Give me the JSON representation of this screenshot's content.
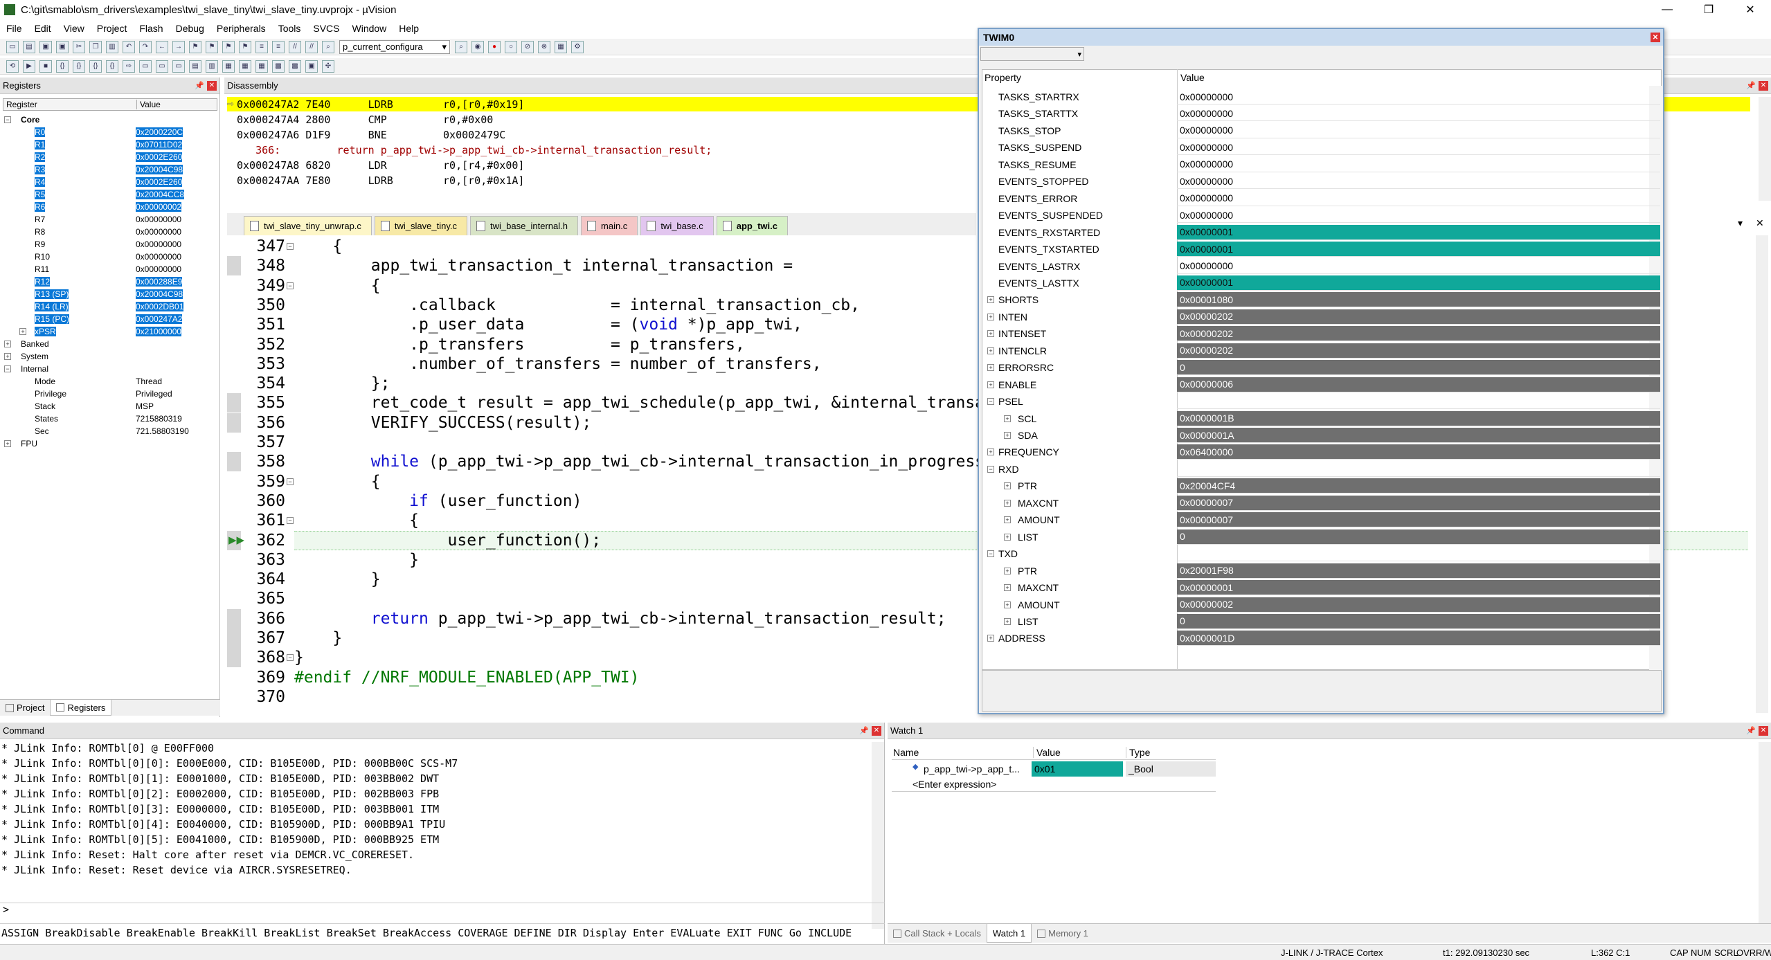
{
  "window": {
    "title": "C:\\git\\smablo\\sm_drivers\\examples\\twi_slave_tiny\\twi_slave_tiny.uvprojx - µVision",
    "minimize": "—",
    "maximize": "❐",
    "close": "✕"
  },
  "menu": [
    "File",
    "Edit",
    "View",
    "Project",
    "Flash",
    "Debug",
    "Peripherals",
    "Tools",
    "SVCS",
    "Window",
    "Help"
  ],
  "toolbar": {
    "config": "p_current_configura"
  },
  "registers": {
    "title": "Registers",
    "col_register": "Register",
    "col_value": "Value",
    "core_label": "Core",
    "rows": [
      {
        "name": "R0",
        "value": "0x2000220C",
        "sel": true
      },
      {
        "name": "R1",
        "value": "0x07011D02",
        "sel": true
      },
      {
        "name": "R2",
        "value": "0x0002E260",
        "sel": true
      },
      {
        "name": "R3",
        "value": "0x20004C98",
        "sel": true
      },
      {
        "name": "R4",
        "value": "0x0002E260",
        "sel": true
      },
      {
        "name": "R5",
        "value": "0x20004CC8",
        "sel": true
      },
      {
        "name": "R6",
        "value": "0x00000002",
        "sel": true
      },
      {
        "name": "R7",
        "value": "0x00000000",
        "sel": false
      },
      {
        "name": "R8",
        "value": "0x00000000",
        "sel": false
      },
      {
        "name": "R9",
        "value": "0x00000000",
        "sel": false
      },
      {
        "name": "R10",
        "value": "0x00000000",
        "sel": false
      },
      {
        "name": "R11",
        "value": "0x00000000",
        "sel": false
      },
      {
        "name": "R12",
        "value": "0x000288E9",
        "sel": true
      },
      {
        "name": "R13 (SP)",
        "value": "0x20004C98",
        "sel": true
      },
      {
        "name": "R14 (LR)",
        "value": "0x0002DB01",
        "sel": true
      },
      {
        "name": "R15 (PC)",
        "value": "0x000247A2",
        "sel": true
      },
      {
        "name": "xPSR",
        "value": "0x21000000",
        "sel": true
      }
    ],
    "groups": [
      "Banked",
      "System",
      "Internal"
    ],
    "internal": [
      {
        "name": "Mode",
        "value": "Thread"
      },
      {
        "name": "Privilege",
        "value": "Privileged"
      },
      {
        "name": "Stack",
        "value": "MSP"
      },
      {
        "name": "States",
        "value": "7215880319"
      },
      {
        "name": "Sec",
        "value": "721.58803190"
      }
    ],
    "fpu": "FPU",
    "tab_project": "Project",
    "tab_registers": "Registers"
  },
  "disassembly": {
    "title": "Disassembly",
    "lines": [
      "0x000247A2 7E40      LDRB        r0,[r0,#0x19]",
      "0x000247A4 2800      CMP         r0,#0x00",
      "0x000247A6 D1F9      BNE         0x0002479C",
      "   366:         return p_app_twi->p_app_twi_cb->internal_transaction_result;",
      "0x000247A8 6820      LDR         r0,[r4,#0x00]",
      "0x000247AA 7E80      LDRB        r0,[r0,#0x1A]"
    ]
  },
  "editor": {
    "tabs": [
      "twi_slave_tiny_unwrap.c",
      "twi_slave_tiny.c",
      "twi_base_internal.h",
      "main.c",
      "twi_base.c",
      "app_twi.c"
    ],
    "lines": [
      {
        "n": "347",
        "c": "    {"
      },
      {
        "n": "348",
        "c": "        app_twi_transaction_t internal_transaction ="
      },
      {
        "n": "349",
        "c": "        {"
      },
      {
        "n": "350",
        "c": "            .callback            = internal_transaction_cb,"
      },
      {
        "n": "351",
        "c": "            .p_user_data         = (void *)p_app_twi,"
      },
      {
        "n": "352",
        "c": "            .p_transfers         = p_transfers,"
      },
      {
        "n": "353",
        "c": "            .number_of_transfers = number_of_transfers,"
      },
      {
        "n": "354",
        "c": "        };"
      },
      {
        "n": "355",
        "c": "        ret_code_t result = app_twi_schedule(p_app_twi, &internal_transaction);"
      },
      {
        "n": "356",
        "c": "        VERIFY_SUCCESS(result);"
      },
      {
        "n": "357",
        "c": ""
      },
      {
        "n": "358",
        "c": "        while (p_app_twi->p_app_twi_cb->internal_transaction_in_progress)"
      },
      {
        "n": "359",
        "c": "        {"
      },
      {
        "n": "360",
        "c": "            if (user_function)"
      },
      {
        "n": "361",
        "c": "            {"
      },
      {
        "n": "362",
        "c": "                user_function();"
      },
      {
        "n": "363",
        "c": "            }"
      },
      {
        "n": "364",
        "c": "        }"
      },
      {
        "n": "365",
        "c": ""
      },
      {
        "n": "366",
        "c": "        return p_app_twi->p_app_twi_cb->internal_transaction_result;"
      },
      {
        "n": "367",
        "c": "    }"
      },
      {
        "n": "368",
        "c": "}"
      },
      {
        "n": "369",
        "c": "#endif //NRF_MODULE_ENABLED(APP_TWI)"
      },
      {
        "n": "370",
        "c": ""
      }
    ]
  },
  "twim": {
    "title": "TWIM0",
    "col_property": "Property",
    "col_value": "Value",
    "rows": [
      {
        "name": "TASKS_STARTRX",
        "value": "0x00000000",
        "style": "",
        "lvl": 1,
        "exp": false
      },
      {
        "name": "TASKS_STARTTX",
        "value": "0x00000000",
        "style": "",
        "lvl": 1,
        "exp": false
      },
      {
        "name": "TASKS_STOP",
        "value": "0x00000000",
        "style": "",
        "lvl": 1,
        "exp": false
      },
      {
        "name": "TASKS_SUSPEND",
        "value": "0x00000000",
        "style": "",
        "lvl": 1,
        "exp": false
      },
      {
        "name": "TASKS_RESUME",
        "value": "0x00000000",
        "style": "",
        "lvl": 1,
        "exp": false
      },
      {
        "name": "EVENTS_STOPPED",
        "value": "0x00000000",
        "style": "",
        "lvl": 1,
        "exp": false
      },
      {
        "name": "EVENTS_ERROR",
        "value": "0x00000000",
        "style": "",
        "lvl": 1,
        "exp": false
      },
      {
        "name": "EVENTS_SUSPENDED",
        "value": "0x00000000",
        "style": "",
        "lvl": 1,
        "exp": false
      },
      {
        "name": "EVENTS_RXSTARTED",
        "value": "0x00000001",
        "style": "teal",
        "lvl": 1,
        "exp": false
      },
      {
        "name": "EVENTS_TXSTARTED",
        "value": "0x00000001",
        "style": "teal",
        "lvl": 1,
        "exp": false
      },
      {
        "name": "EVENTS_LASTRX",
        "value": "0x00000000",
        "style": "",
        "lvl": 1,
        "exp": false
      },
      {
        "name": "EVENTS_LASTTX",
        "value": "0x00000001",
        "style": "teal",
        "lvl": 1,
        "exp": false
      },
      {
        "name": "SHORTS",
        "value": "0x00001080",
        "style": "grey",
        "lvl": 1,
        "exp": "+"
      },
      {
        "name": "INTEN",
        "value": "0x00000202",
        "style": "grey",
        "lvl": 1,
        "exp": "+"
      },
      {
        "name": "INTENSET",
        "value": "0x00000202",
        "style": "grey",
        "lvl": 1,
        "exp": "+"
      },
      {
        "name": "INTENCLR",
        "value": "0x00000202",
        "style": "grey",
        "lvl": 1,
        "exp": "+"
      },
      {
        "name": "ERRORSRC",
        "value": "0",
        "style": "grey",
        "lvl": 1,
        "exp": "+"
      },
      {
        "name": "ENABLE",
        "value": "0x00000006",
        "style": "grey",
        "lvl": 1,
        "exp": "+"
      },
      {
        "name": "PSEL",
        "value": "",
        "style": "",
        "lvl": 1,
        "exp": "-"
      },
      {
        "name": "SCL",
        "value": "0x0000001B",
        "style": "grey",
        "lvl": 2,
        "exp": "+"
      },
      {
        "name": "SDA",
        "value": "0x0000001A",
        "style": "grey",
        "lvl": 2,
        "exp": "+"
      },
      {
        "name": "FREQUENCY",
        "value": "0x06400000",
        "style": "grey",
        "lvl": 1,
        "exp": "+"
      },
      {
        "name": "RXD",
        "value": "",
        "style": "",
        "lvl": 1,
        "exp": "-"
      },
      {
        "name": "PTR",
        "value": "0x20004CF4",
        "style": "grey",
        "lvl": 2,
        "exp": "+"
      },
      {
        "name": "MAXCNT",
        "value": "0x00000007",
        "style": "grey",
        "lvl": 2,
        "exp": "+"
      },
      {
        "name": "AMOUNT",
        "value": "0x00000007",
        "style": "grey",
        "lvl": 2,
        "exp": "+"
      },
      {
        "name": "LIST",
        "value": "0",
        "style": "grey",
        "lvl": 2,
        "exp": "+"
      },
      {
        "name": "TXD",
        "value": "",
        "style": "",
        "lvl": 1,
        "exp": "-"
      },
      {
        "name": "PTR",
        "value": "0x20001F98",
        "style": "grey",
        "lvl": 2,
        "exp": "+"
      },
      {
        "name": "MAXCNT",
        "value": "0x00000001",
        "style": "grey",
        "lvl": 2,
        "exp": "+"
      },
      {
        "name": "AMOUNT",
        "value": "0x00000002",
        "style": "grey",
        "lvl": 2,
        "exp": "+"
      },
      {
        "name": "LIST",
        "value": "0",
        "style": "grey",
        "lvl": 2,
        "exp": "+"
      },
      {
        "name": "ADDRESS",
        "value": "0x0000001D",
        "style": "grey",
        "lvl": 1,
        "exp": "+"
      }
    ]
  },
  "command": {
    "title": "Command",
    "lines": [
      "* JLink Info: ROMTbl[0] @ E00FF000",
      "* JLink Info: ROMTbl[0][0]: E000E000, CID: B105E00D, PID: 000BB00C SCS-M7",
      "* JLink Info: ROMTbl[0][1]: E0001000, CID: B105E00D, PID: 003BB002 DWT",
      "* JLink Info: ROMTbl[0][2]: E0002000, CID: B105E00D, PID: 002BB003 FPB",
      "* JLink Info: ROMTbl[0][3]: E0000000, CID: B105E00D, PID: 003BB001 ITM",
      "* JLink Info: ROMTbl[0][4]: E0040000, CID: B105900D, PID: 000BB9A1 TPIU",
      "* JLink Info: ROMTbl[0][5]: E0041000, CID: B105900D, PID: 000BB925 ETM",
      "* JLink Info: Reset: Halt core after reset via DEMCR.VC_CORERESET.",
      "* JLink Info: Reset: Reset device via AIRCR.SYSRESETREQ."
    ],
    "prompt": ">",
    "hint": "ASSIGN BreakDisable BreakEnable BreakKill BreakList BreakSet BreakAccess COVERAGE DEFINE DIR Display Enter EVALuate EXIT FUNC Go INCLUDE"
  },
  "watch": {
    "title": "Watch 1",
    "col_name": "Name",
    "col_value": "Value",
    "col_type": "Type",
    "row_name": "p_app_twi->p_app_t...",
    "row_value": "0x01",
    "row_type": "_Bool",
    "enter": "<Enter expression>",
    "tab_callstack": "Call Stack + Locals",
    "tab_watch": "Watch 1",
    "tab_memory": "Memory 1"
  },
  "status": {
    "jlink": "J-LINK / J-TRACE Cortex",
    "time": "t1: 292.09130230 sec",
    "pos": "L:362 C:1",
    "caps": "CAP",
    "num": "NUM",
    "scrl": "SCRL",
    "ovr": "OVR",
    "rw": "R/W"
  }
}
